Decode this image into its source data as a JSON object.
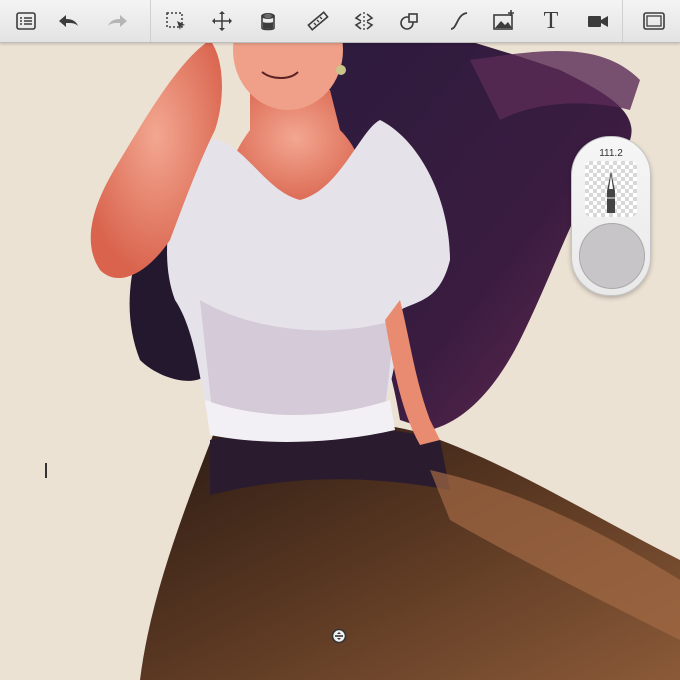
{
  "toolbar": {
    "items": [
      {
        "id": "layers",
        "icon": "list-icon"
      },
      {
        "id": "undo",
        "icon": "undo-arrow-icon"
      },
      {
        "id": "redo",
        "icon": "redo-arrow-icon",
        "disabled": true
      },
      {
        "id": "select",
        "icon": "selection-icon"
      },
      {
        "id": "transform",
        "icon": "move-arrows-icon"
      },
      {
        "id": "fill",
        "icon": "fill-bucket-icon"
      },
      {
        "id": "ruler",
        "icon": "ruler-icon"
      },
      {
        "id": "symmetry",
        "icon": "symmetry-icon"
      },
      {
        "id": "shapes",
        "icon": "shapes-icon"
      },
      {
        "id": "curve",
        "icon": "curve-icon"
      },
      {
        "id": "import-image",
        "icon": "image-add-icon"
      },
      {
        "id": "text",
        "icon": "text-icon",
        "label": "T"
      },
      {
        "id": "time-lapse",
        "icon": "video-camera-icon"
      },
      {
        "id": "fullscreen",
        "icon": "fullscreen-icon"
      }
    ]
  },
  "brush_panel": {
    "size_value": "111.2",
    "opacity_icon": "brush-opacity-icon",
    "current_color": "#c7c5c8"
  },
  "colors": {
    "canvas_background": "#ece2d4",
    "toolbar_background": "#ececec",
    "icon_color": "#3c3c3c",
    "icon_disabled_color": "#b5b5b5"
  },
  "canvas": {
    "scroll_handle_icon": "scroll-indicator-icon"
  }
}
